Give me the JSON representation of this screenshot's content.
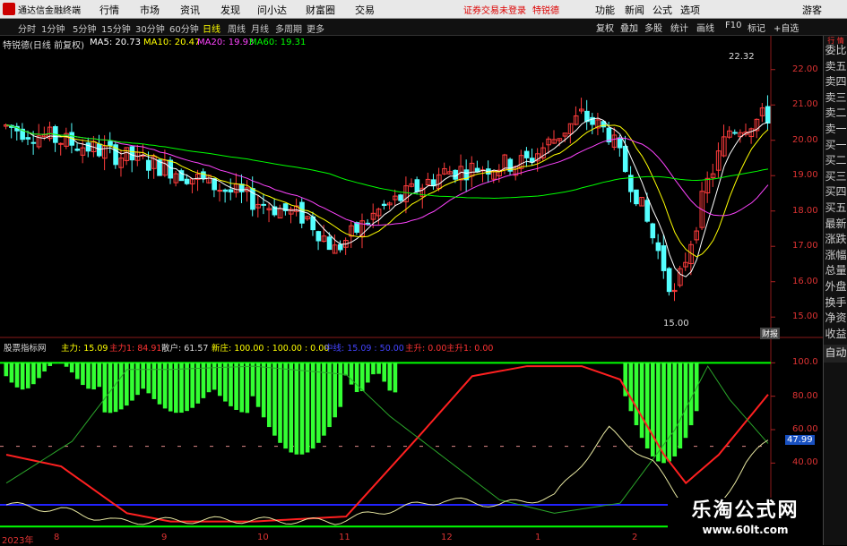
{
  "titlebar": {
    "app_title": "通达信金融终端",
    "menus": [
      "行情",
      "市场",
      "资讯",
      "发现",
      "问小达",
      "财富圈",
      "交易"
    ],
    "warning": "证券交易未登录",
    "stock_name_top": "特锐德",
    "right_menus": [
      "功能",
      "新闻",
      "公式",
      "选项"
    ],
    "guest": "游客"
  },
  "toolbar": {
    "periods": [
      "分时",
      "1分钟",
      "5分钟",
      "15分钟",
      "30分钟",
      "60分钟",
      "日线",
      "周线",
      "月线",
      "多周期",
      "更多"
    ],
    "active_period": "日线",
    "buttons": [
      "复权",
      "叠加",
      "多股",
      "统计",
      "画线",
      "F10",
      "标记",
      "+自选"
    ]
  },
  "infobar": {
    "stock_label": "特锐德(日线 前复权)",
    "ma5": "MA5: 20.73",
    "ma10": "MA10: 20.47",
    "ma20": "MA20: 19.93",
    "ma60": "MA60: 19.31",
    "colors": {
      "ma5": "#ffffff",
      "ma10": "#ffff00",
      "ma20": "#ff44ff",
      "ma60": "#00ff00"
    }
  },
  "price_axis": [
    "22.00",
    "21.00",
    "20.00",
    "19.00",
    "18.00",
    "17.00",
    "16.00",
    "15.00"
  ],
  "price_annotations": {
    "high": "22.32",
    "low": "15.00"
  },
  "indicator_axis": [
    "100.0",
    "80.00",
    "60.00",
    "40.00"
  ],
  "indicator_current": "47.99",
  "indicator_bar": {
    "name": "股票指标网",
    "zhuli": "主力: 15.09",
    "zhuli1": "主力1: 84.91",
    "sanhu": "散户: 61.57",
    "xinzhuang": "新庄: 100.00 : 100.00 : 0.00",
    "zhonglu": "中线: 15.09 : 50.00",
    "zhusheng": "主升: 0.00",
    "zhusheng1": "主升1: 0.00"
  },
  "dates": [
    "2023年",
    "8",
    "9",
    "10",
    "11",
    "12",
    "1",
    "2"
  ],
  "sidebar": [
    "委比",
    "卖五",
    "卖四",
    "卖三",
    "卖二",
    "卖一",
    "买一",
    "买二",
    "买三",
    "买四",
    "买五",
    "最新",
    "涨跌",
    "涨幅",
    "总量",
    "外盘",
    "换手",
    "净资",
    "收益"
  ],
  "sidebar_bottom": "自动",
  "sidebar_top": "行 情",
  "caibao": "财报",
  "watermark": {
    "line1": "乐淘公式网",
    "line2": "www.60lt.com"
  }
}
